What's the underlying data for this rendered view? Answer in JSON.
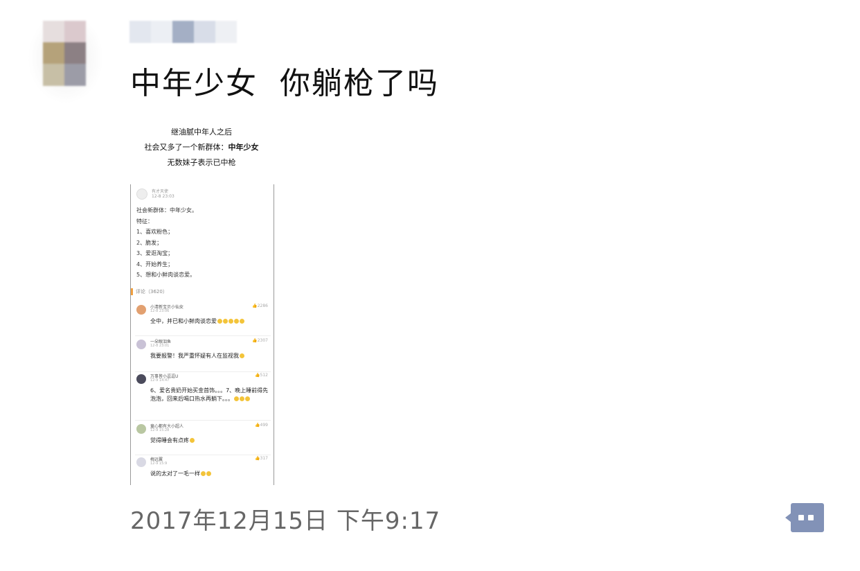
{
  "post": {
    "text": "中年少女  你躺枪了吗",
    "timestamp": "2017年12月15日 下午9:17"
  },
  "image": {
    "caption": [
      "继油腻中年人之后",
      "社会又多了一个新群体：",
      "中年少女",
      "无数妹子表示已中枪"
    ],
    "author": {
      "name": "有才天使",
      "time": "12-8 23:03"
    },
    "body": [
      "社会新群体：中年少女。",
      "特征：",
      "1、喜欢粉色；",
      "2、脆发；",
      "3、爱逛淘宝；",
      "4、开始养生；",
      "5、想和小鲜肉谈恋爱。"
    ],
    "comments_label": "评论（3620）",
    "comments": [
      {
        "name": "小清新宝贝小仙女",
        "time": "12-8 23:06",
        "likes": "2286",
        "text": "全中，并已和小鲜肉谈恋爱",
        "av": "#e2a070"
      },
      {
        "name": "一朵眼泪鱼",
        "time": "12-8 23:01",
        "likes": "2307",
        "text": "我要报警！我严重怀疑有人在监视我",
        "av": "#c9c2d6"
      },
      {
        "name": "万事皆小逗逗U",
        "time": "12-9 14:47",
        "likes": "512",
        "text": "6、爱名贵奶开始买金首饰。。。7、晚上睡前得先泡泡，回来后喝口热水再躺下。。。",
        "av": "#4b4b5c"
      },
      {
        "name": "童心都有大小超人",
        "time": "12-9 15:28",
        "likes": "499",
        "text": "觉得睡会有点疼",
        "av": "#b9c7a2"
      },
      {
        "name": "梅远翼",
        "time": "12-9 15:9",
        "likes": "317",
        "text": "说的太对了一毛一样",
        "av": "#d9d9e4"
      }
    ]
  },
  "icons": {
    "comment_button": "comment-dots-icon"
  },
  "colors": {
    "accent": "#8292b7",
    "timestamp": "#666666"
  }
}
